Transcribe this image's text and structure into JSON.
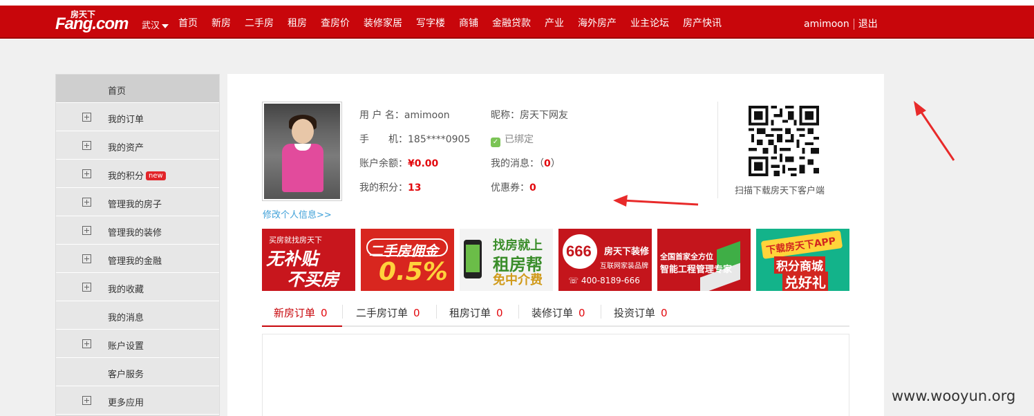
{
  "header": {
    "logo_cn": "房天下",
    "logo_en": "Fang.com",
    "city": "武汉",
    "nav": [
      "首页",
      "新房",
      "二手房",
      "租房",
      "查房价",
      "装修家居",
      "写字楼",
      "商铺",
      "金融贷款",
      "产业",
      "海外房产",
      "业主论坛",
      "房产快讯"
    ],
    "username": "amimoon",
    "logout": "退出"
  },
  "sidebar": {
    "items": [
      {
        "label": "首页",
        "expandable": false,
        "active": true
      },
      {
        "label": "我的订单",
        "expandable": true
      },
      {
        "label": "我的资产",
        "expandable": true
      },
      {
        "label": "我的积分",
        "expandable": true,
        "badge": "new"
      },
      {
        "label": "管理我的房子",
        "expandable": true
      },
      {
        "label": "管理我的装修",
        "expandable": true
      },
      {
        "label": "管理我的金融",
        "expandable": true
      },
      {
        "label": "我的收藏",
        "expandable": true
      },
      {
        "label": "我的消息",
        "expandable": false
      },
      {
        "label": "账户设置",
        "expandable": true
      },
      {
        "label": "客户服务",
        "expandable": false
      },
      {
        "label": "更多应用",
        "expandable": true
      }
    ]
  },
  "profile": {
    "username_label": "用 户 名：",
    "username": "amimoon",
    "nickname_label": "昵称：",
    "nickname": "房天下网友",
    "phone_label": "手　　机：",
    "phone": "185****0905",
    "bound": "已绑定",
    "balance_label": "账户余额：",
    "balance": "¥0.00",
    "messages_label": "我的消息：（",
    "messages": "0",
    "messages_close": "）",
    "points_label": "我的积分：",
    "points": "13",
    "coupons_label": "优惠券：",
    "coupons": "0",
    "edit_link": "修改个人信息>>",
    "qr_caption": "扫描下载房天下客户端"
  },
  "banners": [
    {
      "line1": "买房就找房天下",
      "line2": "无补贴",
      "line3": "不买房",
      "color": "#c8161d"
    },
    {
      "line1": "二手房佣金",
      "line2": "0.5%",
      "color": "#d8261f"
    },
    {
      "line1": "找房就上",
      "line2": "租房帮",
      "line3": "免中介费",
      "color": "#f3f3f3"
    },
    {
      "line1": "房天下装修",
      "line2": "互联网家装品牌",
      "line3": "400-8189-666",
      "badge": "666",
      "color": "#c4151c"
    },
    {
      "line1": "全国首家全方位",
      "line2": "智能工程管理专家",
      "color": "#c4151c"
    },
    {
      "line1": "下载房天下APP",
      "line2": "积分商城",
      "line3": "兑好礼",
      "color": "#13b38a"
    }
  ],
  "order_tabs": [
    {
      "label": "新房订单",
      "count": "0",
      "active": true
    },
    {
      "label": "二手房订单",
      "count": "0"
    },
    {
      "label": "租房订单",
      "count": "0"
    },
    {
      "label": "装修订单",
      "count": "0"
    },
    {
      "label": "投资订单",
      "count": "0"
    }
  ],
  "watermark": "www.wooyun.org"
}
